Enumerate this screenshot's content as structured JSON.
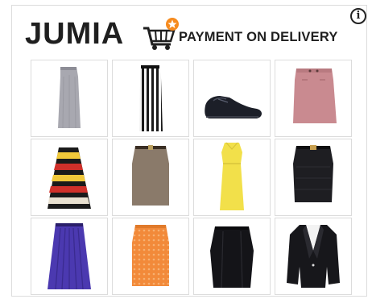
{
  "brand": {
    "name": "JUMIA",
    "tagline": "PAYMENT ON DELIVERY"
  },
  "info_button": {
    "label": "i"
  },
  "products": [
    {
      "icon": "grey-maxi-skirt-icon"
    },
    {
      "icon": "striped-maxi-skirt-icon"
    },
    {
      "icon": "black-leather-shoe-icon"
    },
    {
      "icon": "pink-pencil-skirt-icon"
    },
    {
      "icon": "striped-flared-skirt-icon"
    },
    {
      "icon": "brown-pencil-skirt-icon"
    },
    {
      "icon": "yellow-dress-icon"
    },
    {
      "icon": "black-pencil-skirt-icon"
    },
    {
      "icon": "purple-pleated-skirt-icon"
    },
    {
      "icon": "orange-lace-skirt-icon"
    },
    {
      "icon": "black-tulip-skirt-icon"
    },
    {
      "icon": "black-blazer-icon"
    }
  ],
  "colors": {
    "brand_orange": "#f68b1e",
    "text": "#1f1f1f",
    "border": "#dcdcdc"
  }
}
